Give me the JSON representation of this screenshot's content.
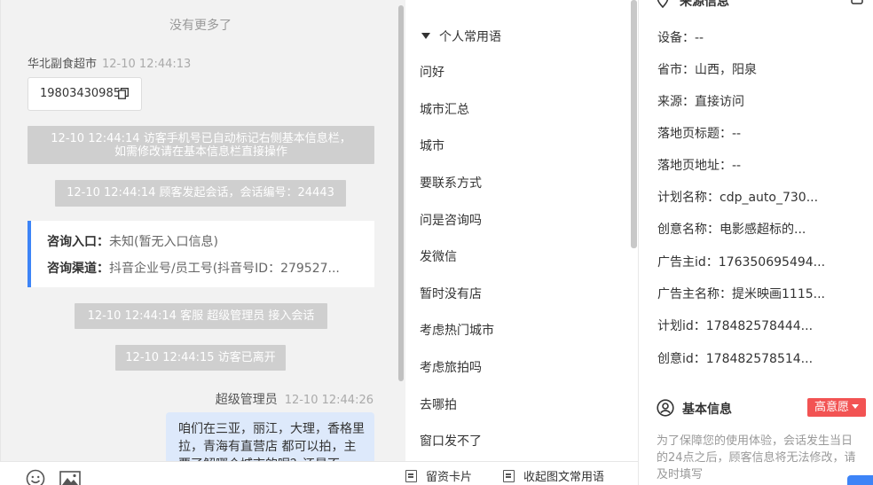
{
  "chat": {
    "no_more": "没有更多了",
    "visitor_name": "华北副食超市",
    "visitor_time": "12-10 12:44:13",
    "phone": "19803430985",
    "system_messages": [
      "12-10 12:44:14 访客手机号已自动标记右侧基本信息栏，",
      "如需修改请在基本信息栏直接操作",
      "12-10 12:44:14 顾客发起会话，会话编号：24443",
      "12-10 12:44:14 客服 超级管理员 接入会话",
      "12-10 12:44:15 访客已离开"
    ],
    "info_card": {
      "entry_label": "咨询入口：",
      "entry_value": "未知(暂无入口信息)",
      "channel_label": "咨询渠道：",
      "channel_value": "抖音企业号/员工号(抖音号ID：279527..."
    },
    "agent_name": "超级管理员",
    "agent_time": "12-10 12:44:26",
    "agent_message": "咱们在三亚，丽江，大理，香格里拉，青海有直营店 都可以拍，主要了解哪个城市的呢？还是不"
  },
  "quick_replies": {
    "group_title": "个人常用语",
    "items": [
      "问好",
      "城市汇总",
      "城市",
      "要联系方式",
      "问是咨询吗",
      "发微信",
      "暂时没有店",
      "考虑热门城市",
      "考虑旅拍吗",
      "去哪拍",
      "窗口发不了"
    ],
    "bottom_left": "留资卡片",
    "bottom_right": "收起图文常用语"
  },
  "source_info": {
    "title": "来源信息",
    "fields": [
      "设备：--",
      "省市：山西，阳泉",
      "来源：直接访问",
      "落地页标题：--",
      "落地页地址：--",
      "计划名称：cdp_auto_730...",
      "创意名称：电影感超标的...",
      "广告主id：176350695494...",
      "广告主名称：提米映画1115...",
      "计划id：178482578444...",
      "创意id：178482578514..."
    ]
  },
  "basic_info": {
    "title": "基本信息",
    "intent_badge": "高意愿",
    "notice": "为了保障您的使用体验，会话发生当日的24点之后，顾客信息将无法修改，请及时填写"
  },
  "colors": {
    "accent": "#3d84f7",
    "badge": "#f25353",
    "system_bubble": "#cfcfcf",
    "agent_bubble": "#dde9fb"
  }
}
